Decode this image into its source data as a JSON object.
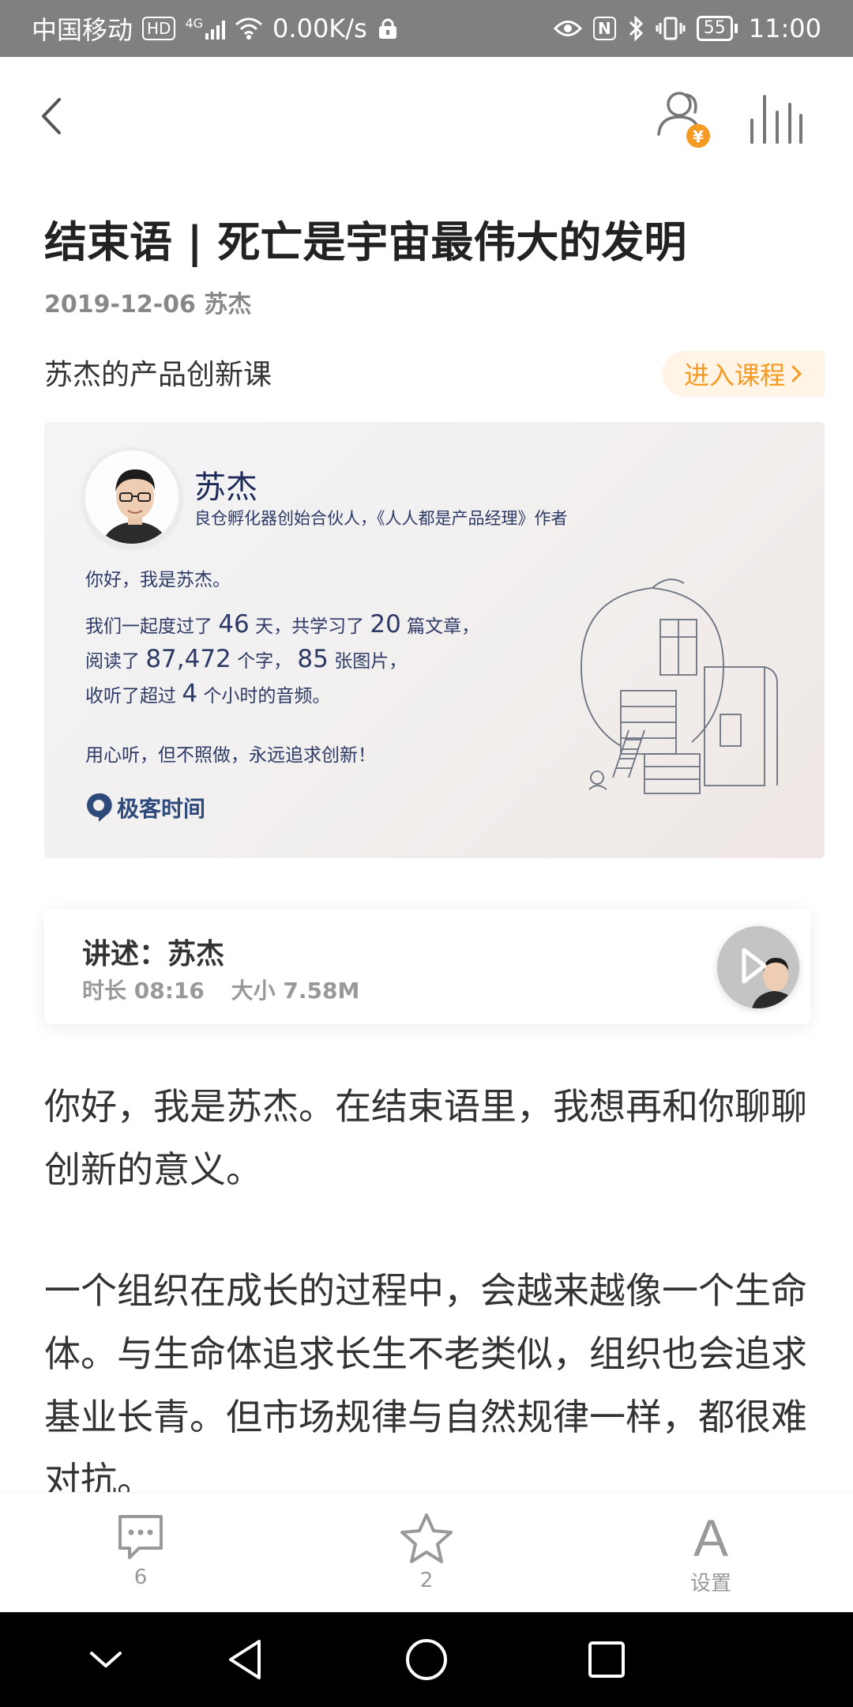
{
  "status_bar": {
    "carrier": "中国移动",
    "hd_badge": "HD",
    "network": "4G",
    "speed": "0.00K/s",
    "nfc": "N",
    "battery": "55",
    "time": "11:00"
  },
  "article": {
    "title": "结束语 | 死亡是宇宙最伟大的发明",
    "date": "2019-12-06",
    "author": "苏杰",
    "course_name": "苏杰的产品创新课",
    "enter_course_label": "进入课程"
  },
  "summary_card": {
    "name": "苏杰",
    "bio": "良仓孵化器创始合伙人，《人人都是产品经理》作者",
    "greeting": "你好，我是苏杰。",
    "line1_a": "我们一起度过了",
    "days": "46",
    "line1_b": "天，共学习了",
    "articles": "20",
    "line1_c": "篇文章，",
    "line2_a": "阅读了",
    "chars": "87,472",
    "line2_b": "个字，",
    "images": "85",
    "line2_c": "张图片，",
    "line3_a": "收听了超过",
    "hours": "4",
    "line3_b": "个小时的音频。",
    "motto": "用心听，但不照做，永远追求创新！",
    "brand": "极客时间"
  },
  "audio": {
    "narrator": "讲述：苏杰",
    "duration": "时长 08:16",
    "size": "大小 7.58M"
  },
  "body": {
    "para1": "你好，我是苏杰。在结束语里，我想再和你聊聊创新的意义。",
    "para2": "一个组织在成长的过程中，会越来越像一个生命体。与生命体追求长生不老类似，组织也会追求基业长青。但市场规律与自然规律一样，都很难对抗。"
  },
  "bottom_bar": {
    "comments_count": "6",
    "favorites_count": "2",
    "settings_label": "设置",
    "font_glyph": "A"
  },
  "icons": {
    "back": "chevron-left-icon",
    "members": "people-coin-icon",
    "stats": "bar-chart-icon",
    "comment": "comment-icon",
    "star": "star-icon",
    "font": "font-settings-icon"
  },
  "colors": {
    "accent": "#f59a23",
    "accent_bg": "#fff4e6",
    "card_text": "#2d3a66"
  }
}
